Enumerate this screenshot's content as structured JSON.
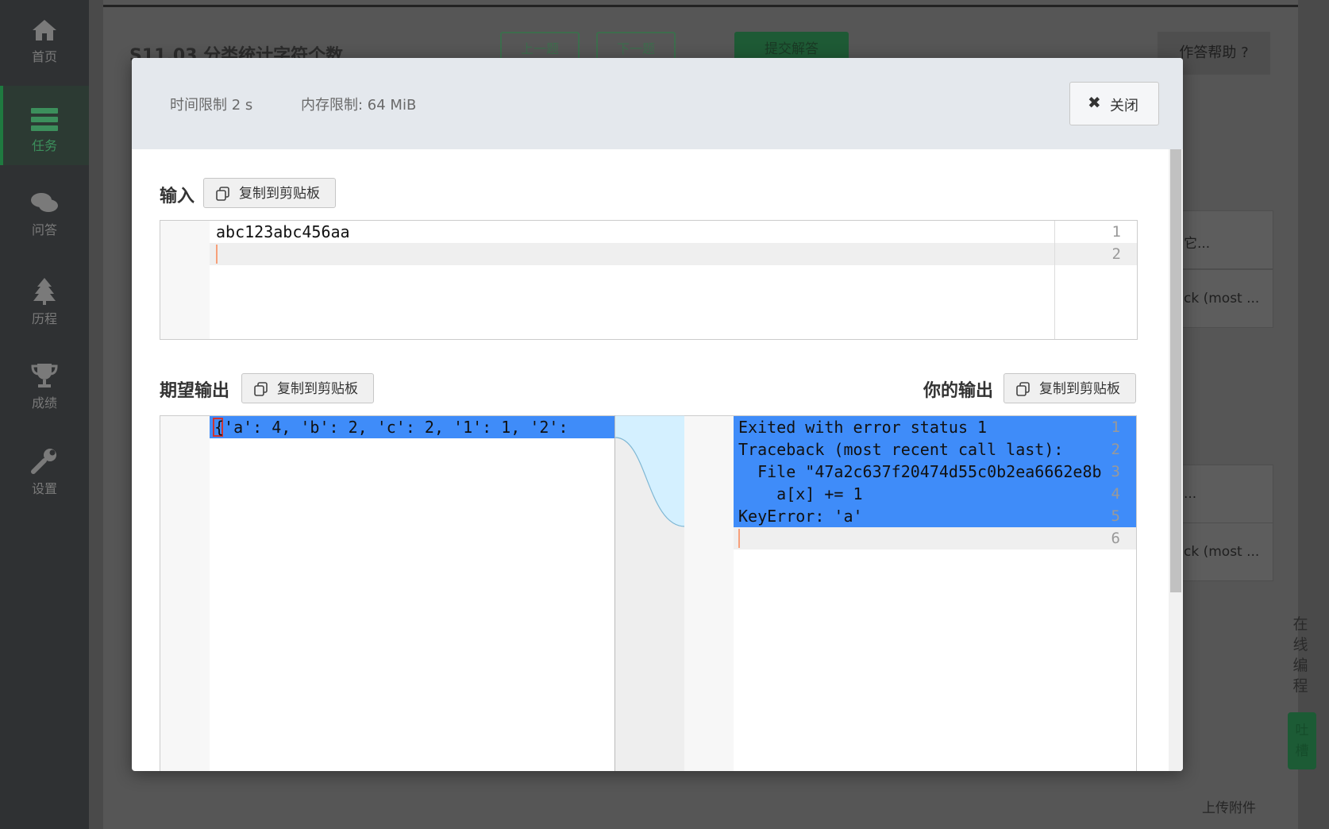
{
  "sidebar": {
    "items": [
      {
        "label": "首页",
        "icon": "home-icon"
      },
      {
        "label": "任务",
        "icon": "tasks-icon",
        "active": true
      },
      {
        "label": "问答",
        "icon": "chat-icon"
      },
      {
        "label": "历程",
        "icon": "tree-icon"
      },
      {
        "label": "成绩",
        "icon": "trophy-icon"
      },
      {
        "label": "设置",
        "icon": "wrench-icon"
      }
    ]
  },
  "background": {
    "title": "S11.03 分类统计字符个数",
    "prev_label": "上一题",
    "next_label": "下一题",
    "submit_label": "提交解答",
    "help_label": "作答帮助",
    "card_snippets": [
      "它...",
      "ck (most ...",
      "...",
      "ck (most ..."
    ],
    "side_vertical": [
      "在",
      "线",
      "编",
      "程"
    ],
    "side_green_vertical": [
      "吐",
      "槽"
    ],
    "upload_label": "上传附件"
  },
  "modal": {
    "time_limit": "时间限制 2 s",
    "memory_limit": "内存限制: 64 MiB",
    "close_label": "关闭",
    "input_section": {
      "title": "输入",
      "copy_label": "复制到剪贴板",
      "lines": [
        "abc123abc456aa",
        ""
      ]
    },
    "expected_section": {
      "title": "期望输出",
      "copy_label": "复制到剪贴板",
      "lines": [
        "{'a': 4, 'b': 2, 'c': 2, '1': 1, '2':"
      ]
    },
    "yours_section": {
      "title": "你的输出",
      "copy_label": "复制到剪贴板",
      "lines": [
        "Exited with error status 1",
        "Traceback (most recent call last):",
        "  File \"47a2c637f20474d55c0b2ea6662e8b",
        "    a[x] += 1",
        "KeyError: 'a'",
        ""
      ]
    }
  },
  "colors": {
    "selection": "#3f8cf9",
    "merge_fill": "#d4f0ff",
    "accent_green": "#1f7a40"
  }
}
